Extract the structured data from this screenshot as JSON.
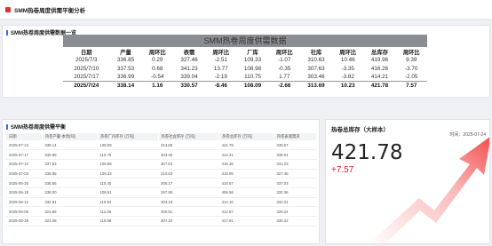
{
  "topbar": {
    "title": "SMM热卷周度供需平衡分析"
  },
  "panel1": {
    "title": "SMM热卷周度供需数据一览",
    "caption": "SMM热卷周度供需数据",
    "headers": [
      "日期",
      "产量",
      "周环比",
      "表需",
      "周环比",
      "厂库",
      "周环比",
      "社库",
      "周环比",
      "总库存",
      "周环比"
    ],
    "rows": [
      [
        "2025/7/3",
        "336.85",
        "0.29",
        "327.46",
        "-2.51",
        "109.33",
        "-1.07",
        "310.63",
        "10.46",
        "419.96",
        "9.39"
      ],
      [
        "2025/7/10",
        "337.53",
        "0.68",
        "341.23",
        "13.77",
        "108.98",
        "-0.35",
        "307.63",
        "-3.35",
        "416.26",
        "-3.70"
      ],
      [
        "2025/7/17",
        "336.99",
        "-0.54",
        "339.04",
        "-2.19",
        "110.75",
        "1.77",
        "303.46",
        "-3.82",
        "414.21",
        "-2.05"
      ]
    ],
    "last_row": [
      "2025/7/24",
      "338.14",
      "1.16",
      "330.57",
      "-8.46",
      "108.09",
      "-2.66",
      "313.69",
      "10.23",
      "421.78",
      "7.57"
    ]
  },
  "panel2": {
    "title": "SMM热卷周度供需平衡",
    "headers": [
      "日期",
      "热卷产量-本周(吨)",
      "热卷厂内库存 (万吨)",
      "热卷社会库存 (万吨)",
      "热卷总库存 (万吨)",
      "热卷表观需求"
    ],
    "rows": [
      [
        "2025-07-24",
        "338.14",
        "108.09",
        "313.69",
        "421.78",
        "330.57"
      ],
      [
        "2025-07-17",
        "336.99",
        "110.75",
        "303.46",
        "414.21",
        "339.04"
      ],
      [
        "2025-07-10",
        "337.53",
        "108.98",
        "307.63",
        "416.26",
        "341.23"
      ],
      [
        "2025-07-03",
        "336.85",
        "109.33",
        "310.63",
        "419.96",
        "327.46"
      ],
      [
        "2025-06-26",
        "336.56",
        "110.40",
        "300.17",
        "410.57",
        "337.03"
      ],
      [
        "2025-06-19",
        "338.00",
        "108.61",
        "297.95",
        "406.56",
        "332.36"
      ],
      [
        "2025-06-12",
        "332.81",
        "110.94",
        "303.16",
        "414.10",
        "334.01"
      ],
      [
        "2025-06-05",
        "323.89",
        "112.06",
        "300.51",
        "412.57",
        "329.24"
      ],
      [
        "2025-05-29",
        "323.28",
        "110.58",
        "307.33",
        "417.91",
        "330.32"
      ]
    ]
  },
  "panel3": {
    "title": "热卷总库存（大样本）",
    "date": "时间：2025-07-24",
    "value": "421.78",
    "delta": "+7.57",
    "arrow_color": "#f23a3a"
  }
}
